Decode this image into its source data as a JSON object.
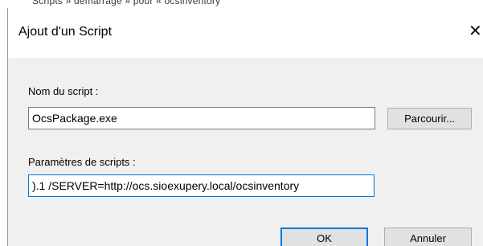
{
  "background": {
    "partial_text": "Scripts » démarrage » pour « ocsinventory"
  },
  "dialog": {
    "title": "Ajout d'un Script",
    "close_glyph": "✕",
    "script_name": {
      "label": "Nom du script :",
      "value": "OcsPackage.exe"
    },
    "browse_label": "Parcourir...",
    "script_params": {
      "label": "Paramètres de scripts :",
      "value": ").1 /SERVER=http://ocs.sioexupery.local/ocsinventory"
    },
    "ok_label": "OK",
    "cancel_label": "Annuler"
  },
  "colors": {
    "focus_border": "#0078d7",
    "client_background": "#f0f0f0",
    "button_face": "#e1e1e1"
  }
}
